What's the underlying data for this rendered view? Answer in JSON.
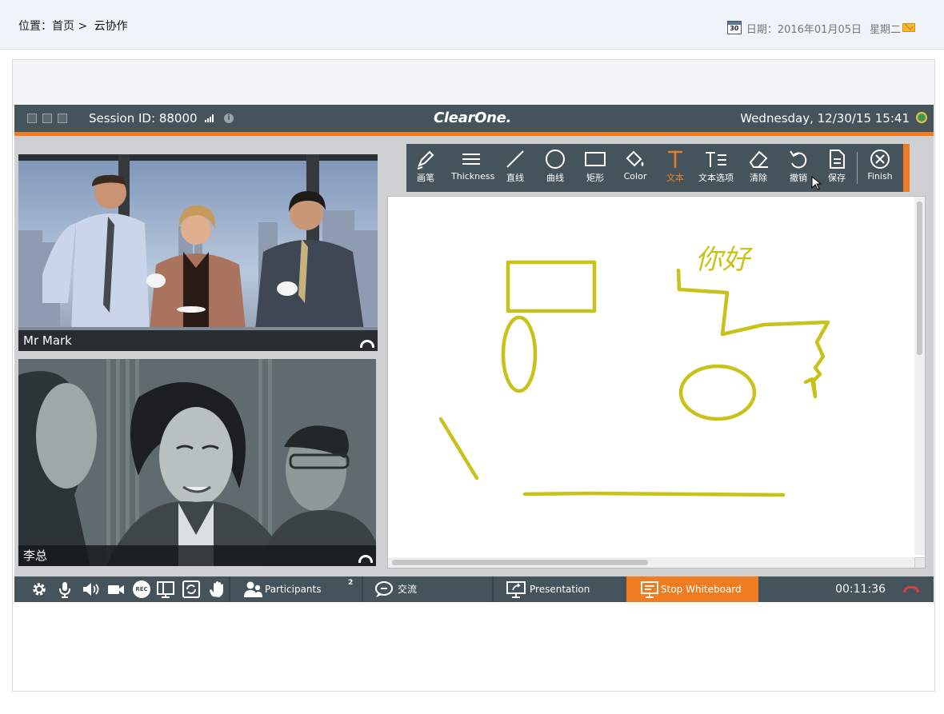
{
  "breadcrumb": {
    "prefix": "位置：首页 >",
    "current": "云协作"
  },
  "header": {
    "date_label": "日期：2016年01月05日",
    "weekday": "星期二",
    "calendar_icon_text": "30"
  },
  "app": {
    "session_label": "Session ID:",
    "session_id": "88000",
    "brand": "ClearOne.",
    "datetime": "Wednesday, 12/30/15  15:41"
  },
  "videos": [
    {
      "name": "Mr Mark"
    },
    {
      "name": "李总"
    }
  ],
  "toolbar": {
    "tools": [
      {
        "label": "画笔",
        "icon": "pen-icon"
      },
      {
        "label": "Thickness",
        "icon": "thickness-icon"
      },
      {
        "label": "直线",
        "icon": "line-icon"
      },
      {
        "label": "曲线",
        "icon": "circle-icon"
      },
      {
        "label": "矩形",
        "icon": "rectangle-icon"
      },
      {
        "label": "Color",
        "icon": "paint-bucket-icon"
      },
      {
        "label": "文本",
        "icon": "text-icon",
        "active": true
      },
      {
        "label": "文本选项",
        "icon": "text-options-icon"
      },
      {
        "label": "清除",
        "icon": "eraser-icon"
      },
      {
        "label": "撤销",
        "icon": "undo-icon"
      },
      {
        "label": "保存",
        "icon": "save-icon"
      },
      {
        "label": "Finish",
        "icon": "finish-icon"
      }
    ]
  },
  "whiteboard": {
    "handwritten_text": "你好",
    "stroke_color": "#c8c21a"
  },
  "bottombar": {
    "icons": [
      "settings-icon",
      "microphone-icon",
      "speaker-icon",
      "camera-icon",
      "record-icon",
      "layout-icon",
      "switch-icon",
      "raise-hand-icon"
    ],
    "record_text": "REC",
    "participants_label": "Participants",
    "participants_count": "2",
    "chat_label": "交流",
    "presentation_label": "Presentation",
    "stop_whiteboard_label": "Stop Whiteboard",
    "timer": "00:11:36"
  },
  "colors": {
    "accent": "#f07c22",
    "app_dark": "#45535c",
    "header_bg": "#eef4f9"
  }
}
